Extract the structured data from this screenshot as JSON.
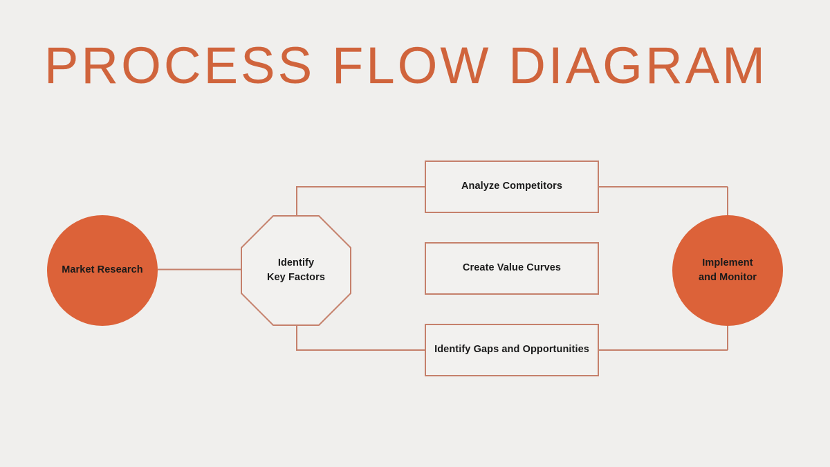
{
  "slide": {
    "title": "PROCESS FLOW DIAGRAM",
    "background_color": "#F0EFED",
    "accent_color": "#DC6239",
    "title_color": "#D0643C",
    "line_color": "#C5806B",
    "node_fill_color": "#F2F1EF",
    "node_text_color": "#1A1A1A"
  },
  "diagram": {
    "nodes": [
      {
        "id": "market-research",
        "label": "Market Research",
        "shape": "circle",
        "fill": "#DC6239"
      },
      {
        "id": "identify-key-factors",
        "label": "Identify\nKey Factors",
        "shape": "octagon",
        "fill": "#F2F1EF"
      },
      {
        "id": "analyze-competitors",
        "label": "Analyze Competitors",
        "shape": "rectangle",
        "fill": "#F2F1EF"
      },
      {
        "id": "create-value-curves",
        "label": "Create Value Curves",
        "shape": "rectangle",
        "fill": "#F2F1EF"
      },
      {
        "id": "identify-gaps",
        "label": "Identify Gaps and Opportunities",
        "shape": "rectangle",
        "fill": "#F2F1EF"
      },
      {
        "id": "implement-and-monitor",
        "label": "Implement\nand Monitor",
        "shape": "circle",
        "fill": "#DC6239"
      }
    ],
    "connectors": [
      {
        "from": "market-research",
        "to": "identify-key-factors",
        "style": "straight"
      },
      {
        "from": "identify-key-factors",
        "to": "analyze-competitors",
        "style": "elbow-up"
      },
      {
        "from": "identify-key-factors",
        "to": "identify-gaps",
        "style": "elbow-down"
      },
      {
        "from": "analyze-competitors",
        "to": "implement-and-monitor",
        "style": "elbow-down"
      },
      {
        "from": "identify-gaps",
        "to": "implement-and-monitor",
        "style": "elbow-up"
      }
    ]
  }
}
